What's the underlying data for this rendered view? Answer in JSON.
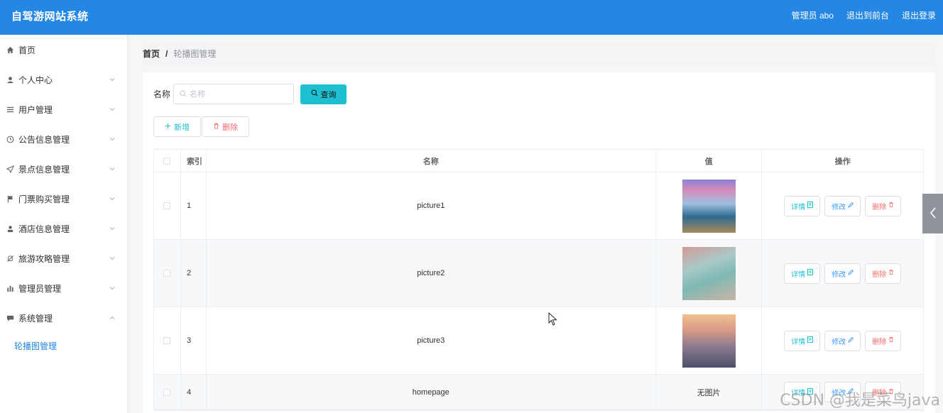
{
  "header": {
    "title": "自驾游网站系统",
    "user_label": "管理员 abo",
    "to_front": "退出到前台",
    "logout": "退出登录",
    "bg_color": "#2587e4"
  },
  "sidebar": {
    "items": [
      {
        "label": "首页",
        "icon": "home-icon",
        "has_chevron": false
      },
      {
        "label": "个人中心",
        "icon": "user-icon",
        "has_chevron": true
      },
      {
        "label": "用户管理",
        "icon": "list-icon",
        "has_chevron": true
      },
      {
        "label": "公告信息管理",
        "icon": "clock-icon",
        "has_chevron": true
      },
      {
        "label": "景点信息管理",
        "icon": "send-icon",
        "has_chevron": true
      },
      {
        "label": "门票购买管理",
        "icon": "flag-icon",
        "has_chevron": true
      },
      {
        "label": "酒店信息管理",
        "icon": "person-icon",
        "has_chevron": true
      },
      {
        "label": "旅游攻略管理",
        "icon": "bell-off-icon",
        "has_chevron": true
      },
      {
        "label": "管理员管理",
        "icon": "bar-chart-icon",
        "has_chevron": true
      },
      {
        "label": "系统管理",
        "icon": "chat-icon",
        "has_chevron": true
      }
    ],
    "submenu": {
      "label": "轮播图管理"
    }
  },
  "breadcrumb": {
    "home": "首页",
    "sep": "/",
    "current": "轮播图管理"
  },
  "search": {
    "label": "名称",
    "placeholder": "名称",
    "query_button": "查询"
  },
  "actions": {
    "add": "新增",
    "delete": "删除"
  },
  "table": {
    "headers": {
      "index": "索引",
      "name": "名称",
      "value": "值",
      "ops": "操作"
    },
    "rows": [
      {
        "index": "1",
        "name": "picture1",
        "value": "",
        "has_image": true
      },
      {
        "index": "2",
        "name": "picture2",
        "value": "",
        "has_image": true
      },
      {
        "index": "3",
        "name": "picture3",
        "value": "",
        "has_image": true
      },
      {
        "index": "4",
        "name": "homepage",
        "value": "无图片",
        "has_image": false
      }
    ],
    "op_labels": {
      "detail": "详情",
      "edit": "修改",
      "delete": "删除"
    }
  },
  "watermark": "CSDN @我是菜鸟java",
  "colors": {
    "accent": "#2587e4",
    "cyan": "#1fbfd2",
    "danger": "#f56c6c",
    "primary": "#409eff"
  }
}
